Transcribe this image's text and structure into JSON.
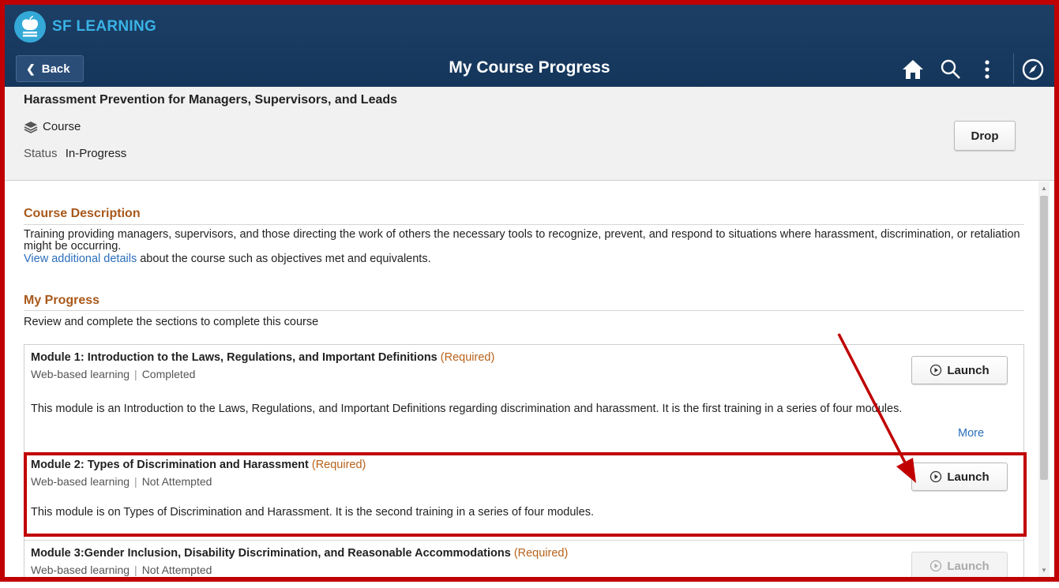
{
  "app": {
    "brand": "SF LEARNING"
  },
  "nav": {
    "back_label": "Back",
    "title": "My Course Progress"
  },
  "course": {
    "title": "Harassment Prevention for Managers, Supervisors, and Leads",
    "type": "Course",
    "status_label": "Status",
    "status_value": "In-Progress",
    "drop_label": "Drop"
  },
  "description": {
    "heading": "Course Description",
    "text": "Training providing managers, supervisors, and those directing the work of others the necessary tools to recognize, prevent, and respond to situations where harassment, discrimination, or retaliation might be occurring.",
    "link_text": "View additional details",
    "link_suffix": " about the course such as objectives met and equivalents."
  },
  "progress": {
    "heading": "My Progress",
    "instructions": "Review and complete the sections to complete this course",
    "modules": [
      {
        "title": "Module 1: Introduction to the Laws, Regulations, and Important Definitions",
        "required": "(Required)",
        "type": "Web-based learning",
        "status": "Completed",
        "description": "This module is an Introduction to the Laws, Regulations, and Important Definitions regarding discrimination and harassment. It is the first training in a series of four modules.",
        "launch_label": "Launch",
        "more_label": "More"
      },
      {
        "title": "Module 2: Types of Discrimination and Harassment",
        "required": "(Required)",
        "type": "Web-based learning",
        "status": "Not Attempted",
        "description": "This module is on Types of Discrimination and Harassment. It is the second training in a series of four modules.",
        "launch_label": "Launch"
      },
      {
        "title": "Module 3:Gender Inclusion, Disability Discrimination, and Reasonable Accommodations",
        "required": "(Required)",
        "type": "Web-based learning",
        "status": "Not Attempted",
        "launch_label": "Launch"
      }
    ]
  },
  "colors": {
    "header_bg": "#15365b",
    "brand": "#39b3e6",
    "section_heading": "#a8581a",
    "required": "#b8621b",
    "link": "#2a6ebb",
    "annotation_red": "#c00000"
  }
}
